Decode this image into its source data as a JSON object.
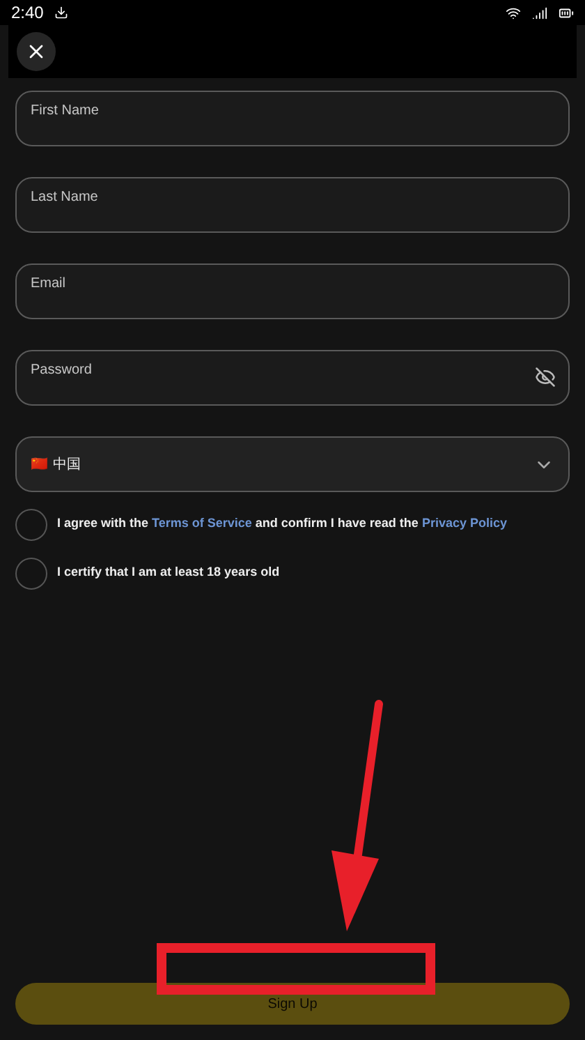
{
  "status_bar": {
    "time": "2:40"
  },
  "fields": [
    {
      "placeholder": "First Name",
      "kind": "text"
    },
    {
      "placeholder": "Last Name",
      "kind": "text"
    },
    {
      "placeholder": "Email",
      "kind": "text"
    },
    {
      "placeholder": "Password",
      "kind": "password"
    }
  ],
  "country_select": {
    "flag": "🇨🇳",
    "value": "中国"
  },
  "checkboxes": [
    {
      "parts": [
        "I agree with the ",
        "Terms of Service",
        " and confirm I have read the ",
        "Privacy Policy"
      ],
      "checked": false
    },
    {
      "parts": [
        "I certify that I am at least 18 years old"
      ],
      "checked": false
    }
  ],
  "submit": {
    "label": "Sign Up",
    "disabled": true
  }
}
